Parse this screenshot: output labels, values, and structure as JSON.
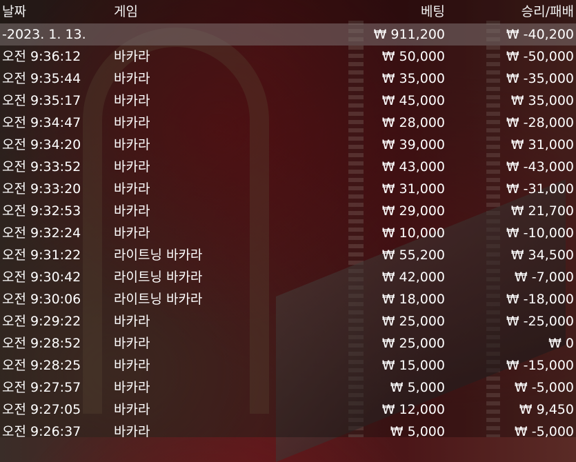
{
  "header": {
    "date": "날짜",
    "game": "게임",
    "bet": "베팅",
    "win_loss": "승리/패배"
  },
  "summary": {
    "date": "-2023. 1. 13.",
    "bet": "₩ 911,200",
    "win_loss": "₩ -40,200"
  },
  "rows": [
    {
      "time": "오전 9:36:12",
      "game": "바카라",
      "bet": "₩ 50,000",
      "win_loss": "₩ -50,000"
    },
    {
      "time": "오전 9:35:44",
      "game": "바카라",
      "bet": "₩ 35,000",
      "win_loss": "₩ -35,000"
    },
    {
      "time": "오전 9:35:17",
      "game": "바카라",
      "bet": "₩ 45,000",
      "win_loss": "₩ 35,000"
    },
    {
      "time": "오전 9:34:47",
      "game": "바카라",
      "bet": "₩ 28,000",
      "win_loss": "₩ -28,000"
    },
    {
      "time": "오전 9:34:20",
      "game": "바카라",
      "bet": "₩ 39,000",
      "win_loss": "₩ 31,000"
    },
    {
      "time": "오전 9:33:52",
      "game": "바카라",
      "bet": "₩ 43,000",
      "win_loss": "₩ -43,000"
    },
    {
      "time": "오전 9:33:20",
      "game": "바카라",
      "bet": "₩ 31,000",
      "win_loss": "₩ -31,000"
    },
    {
      "time": "오전 9:32:53",
      "game": "바카라",
      "bet": "₩ 29,000",
      "win_loss": "₩ 21,700"
    },
    {
      "time": "오전 9:32:24",
      "game": "바카라",
      "bet": "₩ 10,000",
      "win_loss": "₩ -10,000"
    },
    {
      "time": "오전 9:31:22",
      "game": "라이트닝 바카라",
      "bet": "₩ 55,200",
      "win_loss": "₩ 34,500"
    },
    {
      "time": "오전 9:30:42",
      "game": "라이트닝 바카라",
      "bet": "₩ 42,000",
      "win_loss": "₩ -7,000"
    },
    {
      "time": "오전 9:30:06",
      "game": "라이트닝 바카라",
      "bet": "₩ 18,000",
      "win_loss": "₩ -18,000"
    },
    {
      "time": "오전 9:29:22",
      "game": "바카라",
      "bet": "₩ 25,000",
      "win_loss": "₩ -25,000"
    },
    {
      "time": "오전 9:28:52",
      "game": "바카라",
      "bet": "₩ 25,000",
      "win_loss": "₩ 0"
    },
    {
      "time": "오전 9:28:25",
      "game": "바카라",
      "bet": "₩ 15,000",
      "win_loss": "₩ -15,000"
    },
    {
      "time": "오전 9:27:57",
      "game": "바카라",
      "bet": "₩ 5,000",
      "win_loss": "₩ -5,000"
    },
    {
      "time": "오전 9:27:05",
      "game": "바카라",
      "bet": "₩ 12,000",
      "win_loss": "₩ 9,450"
    },
    {
      "time": "오전 9:26:37",
      "game": "바카라",
      "bet": "₩ 5,000",
      "win_loss": "₩ -5,000"
    }
  ]
}
